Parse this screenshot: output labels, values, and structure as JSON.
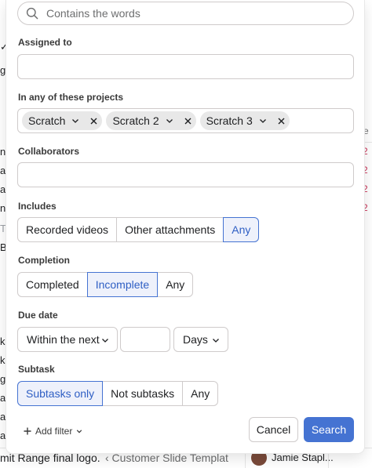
{
  "search": {
    "placeholder": "Contains the words"
  },
  "sections": {
    "assigned_to": "Assigned to",
    "projects": "In any of these projects",
    "collaborators": "Collaborators",
    "includes": "Includes",
    "completion": "Completion",
    "due_date": "Due date",
    "subtask": "Subtask"
  },
  "projects": [
    {
      "label": "Scratch"
    },
    {
      "label": "Scratch 2"
    },
    {
      "label": "Scratch 3"
    }
  ],
  "includes": {
    "options": [
      "Recorded videos",
      "Other attachments",
      "Any"
    ],
    "selected": "Any"
  },
  "completion": {
    "options": [
      "Completed",
      "Incomplete",
      "Any"
    ],
    "selected": "Incomplete"
  },
  "due_date": {
    "range": "Within the next",
    "amount": "",
    "unit": "Days"
  },
  "subtask": {
    "options": [
      "Subtasks only",
      "Not subtasks",
      "Any"
    ],
    "selected": "Subtasks only"
  },
  "footer": {
    "add_filter": "Add filter",
    "cancel": "Cancel",
    "search": "Search"
  },
  "background": {
    "left_fragments": [
      "✓",
      "g",
      "n",
      "ag",
      "ag",
      "n",
      "Ta",
      "B",
      "k",
      "k",
      "g",
      "ag",
      "a",
      "ap",
      "a",
      "a"
    ],
    "right_header": "e",
    "right_fragments": [
      "2",
      "2",
      "2",
      "2"
    ],
    "bottom_task": "mit Range final logo.",
    "bottom_project": "‹ Customer Slide Templat",
    "bottom_assignee": "Jamie Stapl..."
  },
  "colors": {
    "accent": "#4573d2",
    "active_bg": "#eef1fb",
    "border": "#cfcbcb",
    "due_red": "#c92f54"
  }
}
